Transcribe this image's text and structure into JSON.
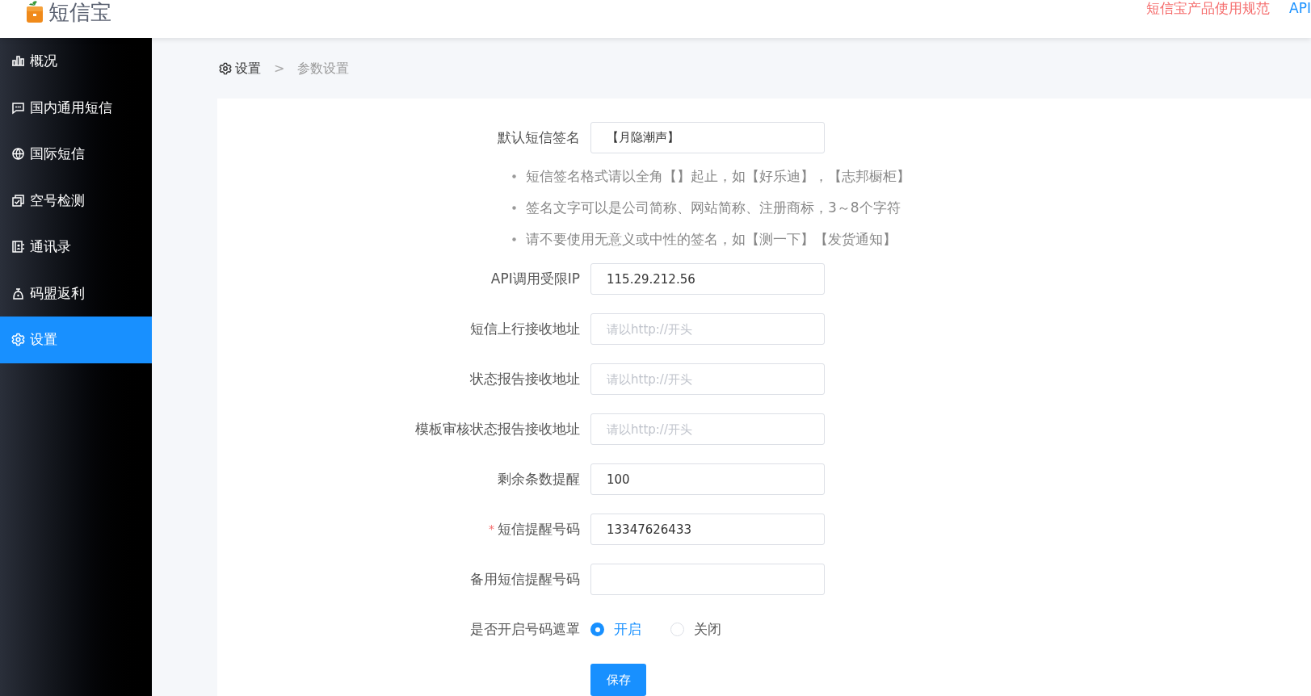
{
  "header": {
    "logo_text": "短信宝",
    "links": [
      {
        "label": "短信宝产品使用规范",
        "kind": "warning"
      },
      {
        "label": "API",
        "kind": "primary"
      }
    ]
  },
  "sidebar": {
    "items": [
      {
        "label": "概况",
        "selected": false
      },
      {
        "label": "国内通用短信",
        "selected": false
      },
      {
        "label": "国际短信",
        "selected": false
      },
      {
        "label": "空号检测",
        "selected": false
      },
      {
        "label": "通讯录",
        "selected": false
      },
      {
        "label": "码盟返利",
        "selected": false
      },
      {
        "label": "设置",
        "selected": true
      }
    ]
  },
  "breadcrumb": {
    "items": [
      "设置",
      "参数设置"
    ],
    "separator": ">"
  },
  "form": {
    "fields": [
      {
        "label": "默认短信签名",
        "value": "【月隐潮声】",
        "hints": [
          "短信签名格式请以全角【】起止，如【好乐迪】，【志邦橱柜】",
          "签名文字可以是公司简称、网站简称、注册商标，3～8个字符",
          "请不要使用无意义或中性的签名，如【测一下】【发货通知】"
        ]
      },
      {
        "label": "API调用受限IP",
        "value": "115.29.212.56"
      },
      {
        "label": "短信上行接收地址",
        "placeholder": "请以http://开头"
      },
      {
        "label": "状态报告接收地址",
        "placeholder": "请以http://开头"
      },
      {
        "label": "模板审核状态报告接收地址",
        "placeholder": "请以http://开头"
      },
      {
        "label": "剩余条数提醒",
        "value": "100"
      },
      {
        "label": "短信提醒号码",
        "value": "13347626433",
        "required_mark": "*"
      },
      {
        "label": "备用短信提醒号码"
      }
    ],
    "radio": {
      "label": "是否开启号码遮罩",
      "options": [
        {
          "label": "开启",
          "selected": true
        },
        {
          "label": "关闭",
          "selected": false
        }
      ]
    },
    "save_button": "保存"
  }
}
